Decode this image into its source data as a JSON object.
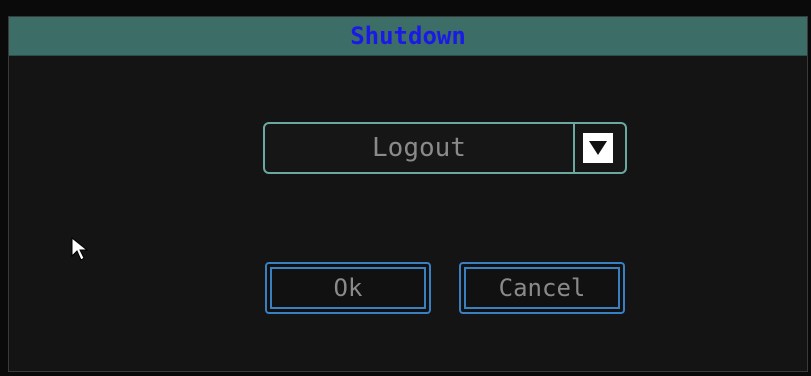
{
  "dialog": {
    "title": "Shutdown",
    "title_color": "#1a1ae6",
    "titlebar_color": "#3c6d67"
  },
  "shutdown_mode": {
    "selected": "Logout",
    "arrow_icon": "triangle-down-icon"
  },
  "buttons": {
    "ok_label": "Ok",
    "cancel_label": "Cancel"
  },
  "cursor": {
    "icon": "mouse-pointer-icon"
  }
}
